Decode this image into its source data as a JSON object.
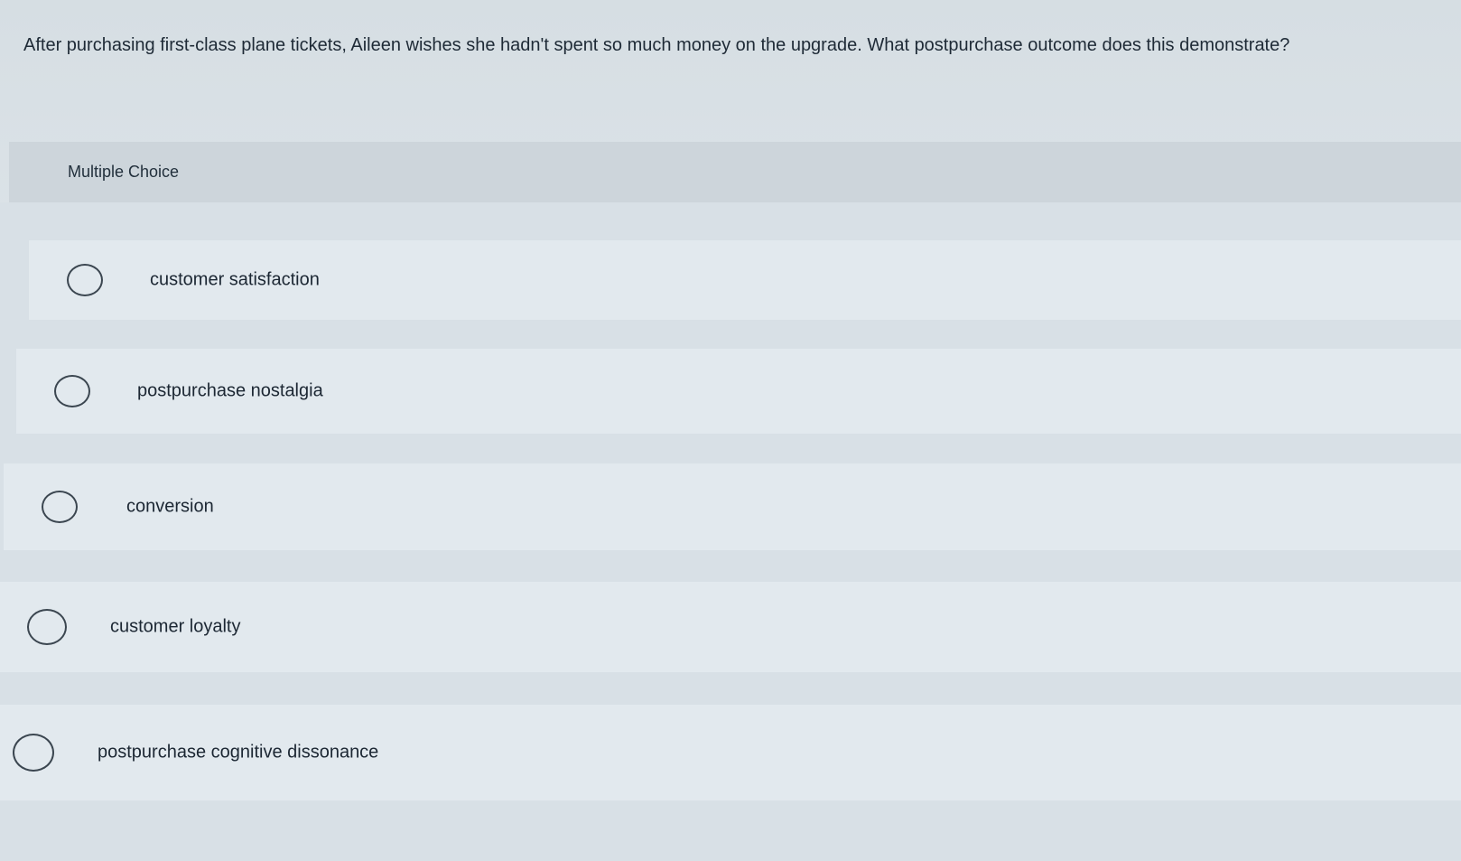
{
  "question": {
    "text": "After purchasing first-class plane tickets, Aileen wishes she hadn't spent so much money on the upgrade. What postpurchase outcome does this demonstrate?"
  },
  "section": {
    "label": "Multiple Choice"
  },
  "options": [
    {
      "label": "customer satisfaction",
      "selected": false
    },
    {
      "label": "postpurchase nostalgia",
      "selected": false
    },
    {
      "label": "conversion",
      "selected": false
    },
    {
      "label": "customer loyalty",
      "selected": false
    },
    {
      "label": "postpurchase cognitive dissonance",
      "selected": false
    }
  ],
  "colors": {
    "background": "#dce3e8",
    "header_band": "#cdd5db",
    "option_row": "#e2e9ee",
    "text": "#1c2733",
    "radio_border": "#3b4650"
  }
}
